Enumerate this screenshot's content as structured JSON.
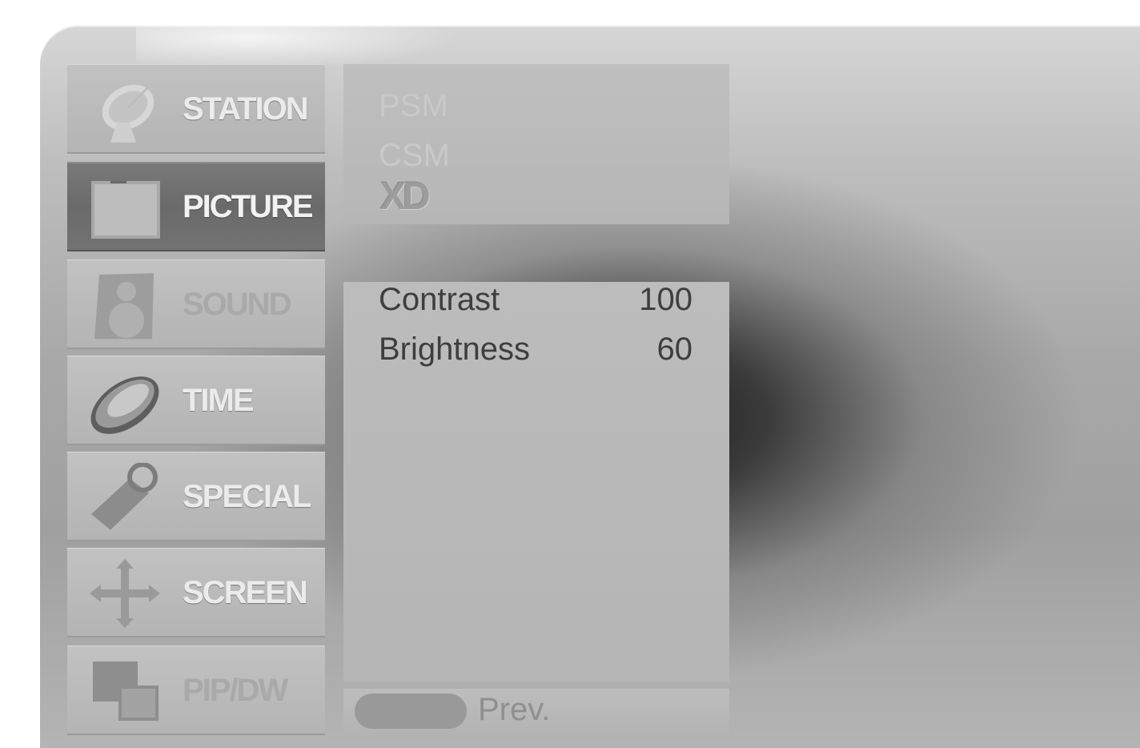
{
  "menu": {
    "items": [
      {
        "label": "STATION",
        "icon": "satellite-dish-icon"
      },
      {
        "label": "PICTURE",
        "icon": "picture-frame-icon"
      },
      {
        "label": "SOUND",
        "icon": "speaker-icon"
      },
      {
        "label": "TIME",
        "icon": "clock-icon"
      },
      {
        "label": "SPECIAL",
        "icon": "key-tag-icon"
      },
      {
        "label": "SCREEN",
        "icon": "move-arrows-icon"
      },
      {
        "label": "PIP/DW",
        "icon": "pip-windows-icon"
      }
    ],
    "selected": "PICTURE"
  },
  "submenu": {
    "options": [
      "PSM",
      "CSM"
    ],
    "xd_logo": "XD"
  },
  "settings": [
    {
      "name": "Contrast",
      "value": "100"
    },
    {
      "name": "Brightness",
      "value": "60"
    }
  ],
  "footer": {
    "prev_label": "Prev."
  }
}
